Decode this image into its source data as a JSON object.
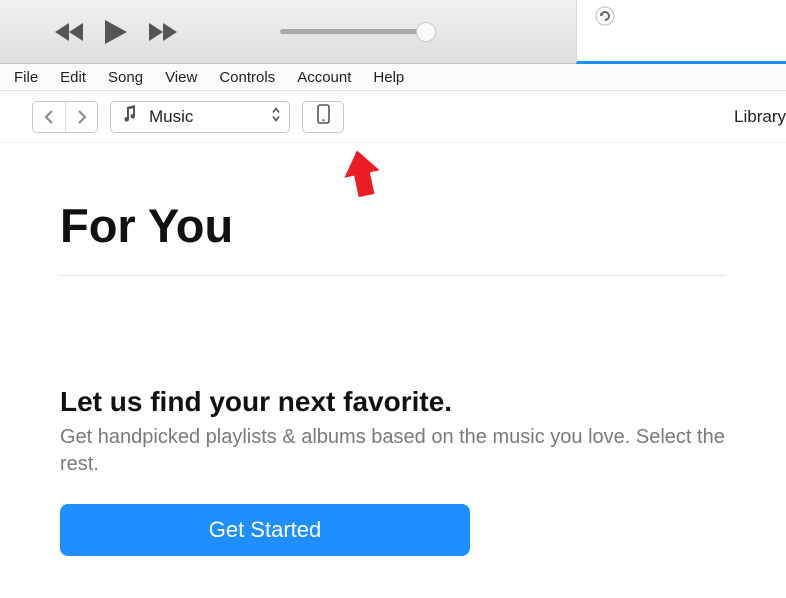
{
  "menu": [
    "File",
    "Edit",
    "Song",
    "View",
    "Controls",
    "Account",
    "Help"
  ],
  "toolbar": {
    "media_selector": "Music",
    "right_nav": "Library"
  },
  "page": {
    "title": "For You",
    "promo_heading": "Let us find your next favorite.",
    "promo_body": "Get handpicked playlists & albums based on the music you love. Select the rest.",
    "cta": "Get Started"
  }
}
